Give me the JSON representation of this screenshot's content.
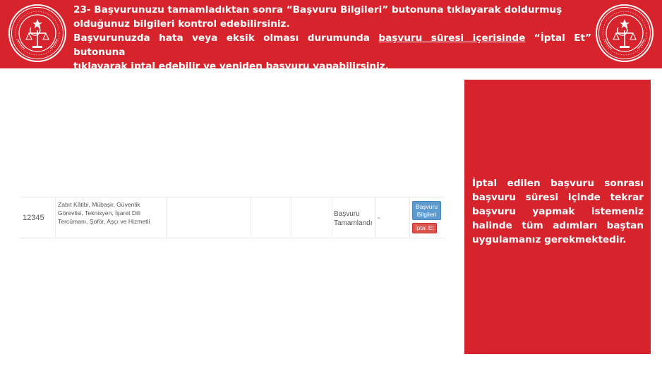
{
  "banner": {
    "line1": "23- Başvurunuzu tamamladıktan sonra “Başvuru Bilgileri” butonuna tıklayarak doldurmuş",
    "line2": "olduğunuz bilgileri kontrol edebilirsiniz.",
    "line3_a": "Başvurunuzda hata veya eksik olması durumunda ",
    "line3_u": "başvuru süresi içerisinde",
    "line3_b": " “İptal Et” butonuna",
    "line4": "tıklayarak iptal edebilir ve yeniden başvuru yapabilirsiniz.",
    "bg_color": "#d6232c"
  },
  "table": {
    "row": {
      "id": "12345",
      "positions": "Zabıt Kâtibi, Mübaşir, Güvenlik Görevlisi, Teknisyen, İşaret Dili Tercümanı, Şoför, Aşçı ve Hizmetli",
      "status": "Başvuru Tamamlandı",
      "extra": "-",
      "info_button": "Başvuru Bilgileri",
      "cancel_button": "İptal Et"
    },
    "info_button_color": "#5d9bcf",
    "cancel_button_color": "#d9534f"
  },
  "side_note": {
    "text": "İptal edilen başvuru sonrası başvuru süresi içinde tekrar başvuru yapmak istemeniz halinde tüm adımları baştan uygulamanız gerekmektedir.",
    "bg_color": "#d6232c"
  },
  "icons": {
    "left_seal": "ministry-seal-icon",
    "right_seal": "ministry-seal-icon"
  }
}
